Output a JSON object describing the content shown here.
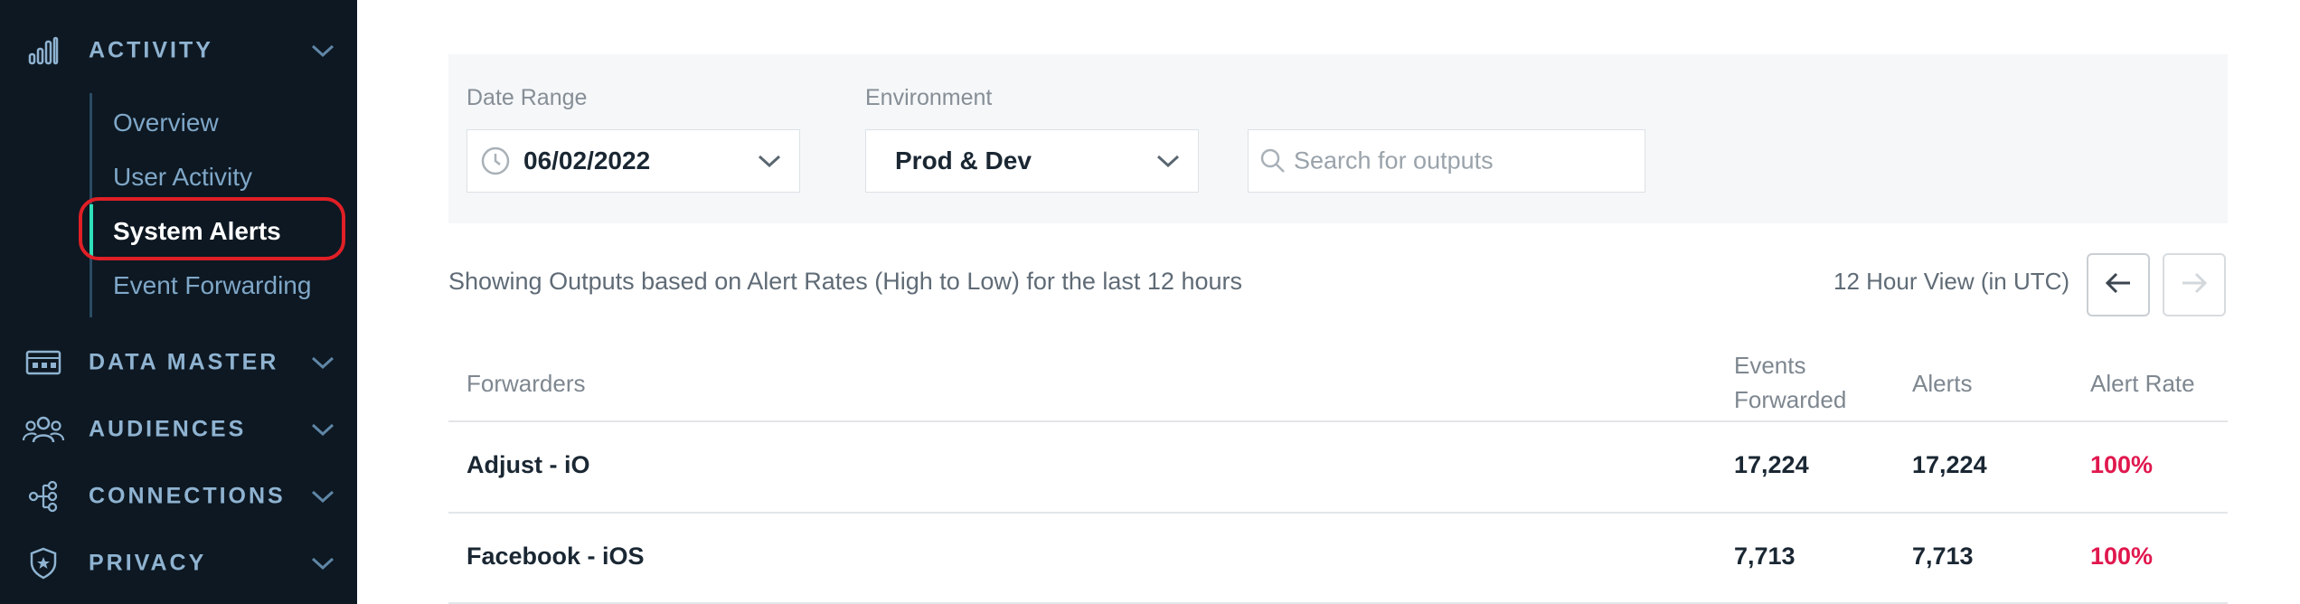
{
  "sidebar": {
    "sections": {
      "activity": {
        "label": "ACTIVITY",
        "icon": "bar-chart-icon"
      },
      "data_master": {
        "label": "DATA MASTER",
        "icon": "data-master-icon"
      },
      "audiences": {
        "label": "AUDIENCES",
        "icon": "people-icon"
      },
      "connections": {
        "label": "CONNECTIONS",
        "icon": "connections-icon"
      },
      "privacy": {
        "label": "PRIVACY",
        "icon": "shield-icon"
      }
    },
    "activity_items": {
      "overview": "Overview",
      "user_activity": "User Activity",
      "system_alerts": "System Alerts",
      "event_forwarding": "Event Forwarding"
    }
  },
  "filters": {
    "date_range_label": "Date Range",
    "date_range_value": "06/02/2022",
    "environment_label": "Environment",
    "environment_value": "Prod & Dev",
    "search_placeholder": "Search for outputs"
  },
  "summary_text": "Showing Outputs based on Alert Rates (High to Low) for the last 12 hours",
  "view_label": "12 Hour View (in UTC)",
  "table": {
    "headers": {
      "forwarders": "Forwarders",
      "events_line1": "Events",
      "events_line2": "Forwarded",
      "alerts": "Alerts",
      "alert_rate": "Alert Rate"
    },
    "rows": [
      {
        "forwarder": "Adjust - iO",
        "events": "17,224",
        "alerts": "17,224",
        "rate": "100%"
      },
      {
        "forwarder": "Facebook - iOS",
        "events": "7,713",
        "alerts": "7,713",
        "rate": "100%"
      }
    ]
  },
  "colors": {
    "sidebar_bg": "#0d1822",
    "active_indicator": "#2fe0b8",
    "highlight": "#e01f26",
    "alert_rate": "#e0184e"
  }
}
